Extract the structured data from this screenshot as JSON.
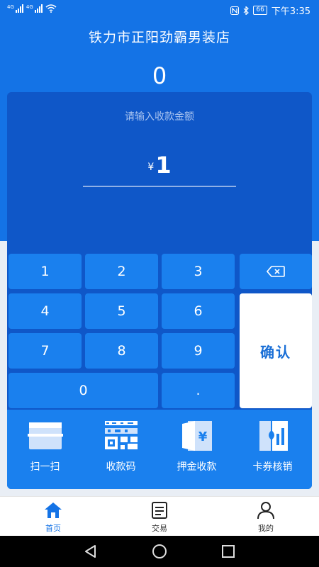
{
  "status_bar": {
    "network_1": "4G",
    "network_2": "4G",
    "battery": "66",
    "time": "下午3:35"
  },
  "header": {
    "store_name": "铁力市正阳劲霸男装店",
    "total_amount": "0"
  },
  "payment": {
    "prompt": "请输入收款金额",
    "currency_symbol": "¥",
    "amount": "1"
  },
  "keypad": {
    "keys": [
      "1",
      "2",
      "3",
      "4",
      "5",
      "6",
      "7",
      "8",
      "9",
      "0",
      "."
    ],
    "backspace_icon": "backspace-icon",
    "confirm_label": "确认"
  },
  "functions": [
    {
      "label": "扫一扫",
      "icon": "scan-icon"
    },
    {
      "label": "收款码",
      "icon": "qr-code-icon"
    },
    {
      "label": "押金收款",
      "icon": "deposit-icon"
    },
    {
      "label": "卡券核销",
      "icon": "coupon-icon"
    }
  ],
  "tabbar": {
    "tabs": [
      {
        "label": "首页",
        "icon": "home-icon",
        "active": true
      },
      {
        "label": "交易",
        "icon": "transactions-icon",
        "active": false
      },
      {
        "label": "我的",
        "icon": "user-icon",
        "active": false
      }
    ]
  },
  "colors": {
    "primary": "#1473e6",
    "panel": "#0f57c8",
    "key": "#1a80ee",
    "confirm_text": "#1a6fd6"
  }
}
